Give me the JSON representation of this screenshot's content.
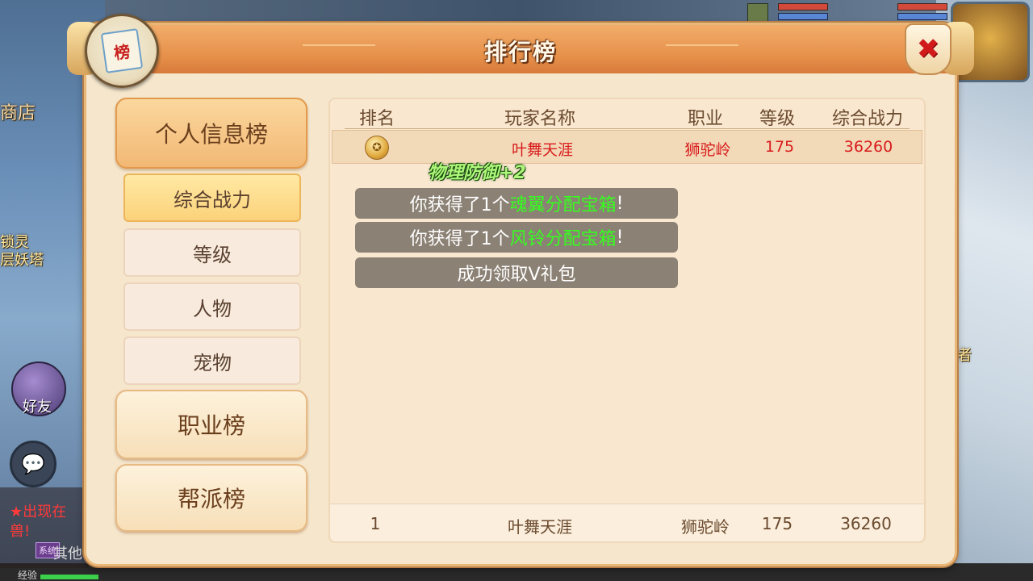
{
  "window": {
    "title": "排行榜",
    "emblem_char": "榜",
    "close_icon": "✖"
  },
  "menu": {
    "categories": [
      {
        "label": "个人信息榜",
        "active": true
      },
      {
        "label": "职业榜",
        "active": false
      },
      {
        "label": "帮派榜",
        "active": false
      }
    ],
    "subitems": [
      {
        "label": "综合战力",
        "active": true
      },
      {
        "label": "等级",
        "active": false
      },
      {
        "label": "人物",
        "active": false
      },
      {
        "label": "宠物",
        "active": false
      }
    ]
  },
  "table": {
    "headers": [
      "排名",
      "玩家名称",
      "职业",
      "等级",
      "综合战力"
    ],
    "rows": [
      {
        "rank_icon": "gold-medal-icon",
        "name": "叶舞天涯",
        "class": "狮驼岭",
        "level": "175",
        "power": "36260"
      }
    ],
    "my_row": {
      "rank": "1",
      "name": "叶舞天涯",
      "class": "狮驼岭",
      "level": "175",
      "power": "36260"
    }
  },
  "notifications": {
    "buff": "物理防御+2",
    "toast1_prefix": "你获得了1个",
    "toast1_item": "魂翼分配宝箱",
    "toast1_suffix": "!",
    "toast2_prefix": "你获得了1个",
    "toast2_item": "风铃分配宝箱",
    "toast2_suffix": "!",
    "toast3": "成功领取V礼包"
  },
  "background": {
    "shop_label": "商店",
    "tower_label_1": "锁灵",
    "tower_label_2": "层妖塔",
    "elder_label": "老者",
    "friend_label": "好友",
    "chat_icon": "💬",
    "chat_line1": "★出现在",
    "chat_line2": "兽!",
    "system_badge": "系统",
    "chat_line3": "其他",
    "exp_label": "经验"
  },
  "colors": {
    "accent": "#e58e48",
    "highlight_text": "#d81c1c",
    "toast_item": "#34ff1e"
  }
}
